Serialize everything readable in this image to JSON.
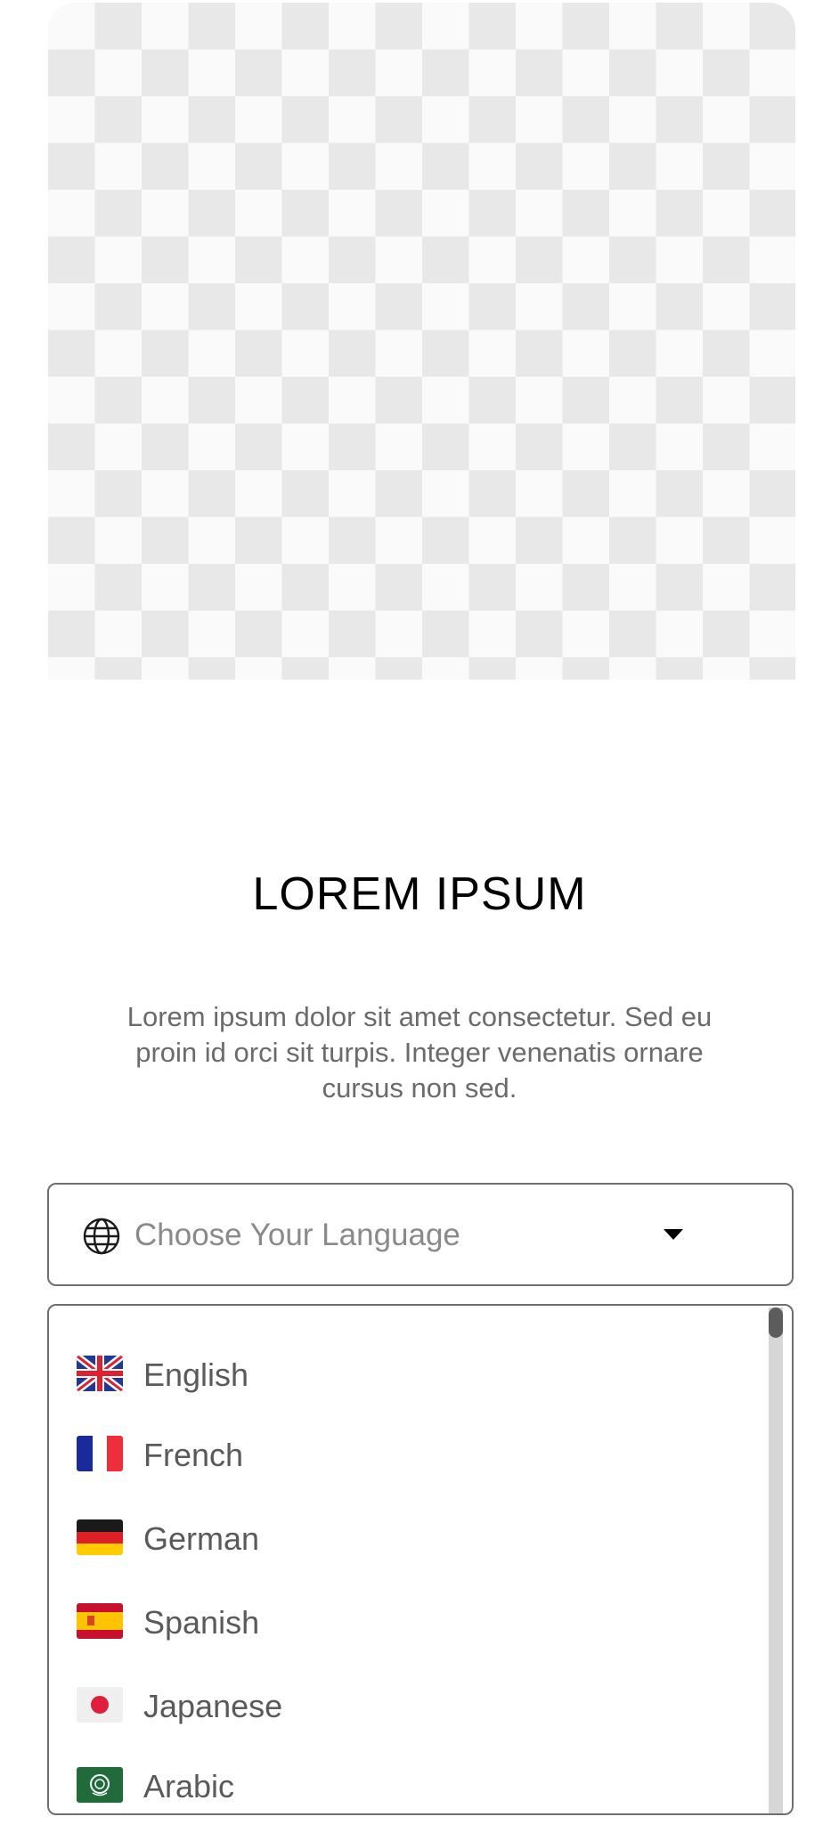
{
  "hero": {
    "image_icon": "checkerboard-placeholder-icon"
  },
  "title": "LOREM IPSUM",
  "description": "Lorem ipsum dolor sit amet consectetur. Sed eu proin id orci sit turpis. Integer venenatis ornare cursus non sed.",
  "language_select": {
    "placeholder": "Choose Your Language",
    "leading_icon": "globe-icon",
    "trailing_icon": "caret-down-icon"
  },
  "languages": [
    {
      "label": "English",
      "flag_icon": "uk-flag-icon"
    },
    {
      "label": "French",
      "flag_icon": "france-flag-icon"
    },
    {
      "label": "German",
      "flag_icon": "germany-flag-icon"
    },
    {
      "label": "Spanish",
      "flag_icon": "spain-flag-icon"
    },
    {
      "label": "Japanese",
      "flag_icon": "japan-flag-icon"
    },
    {
      "label": "Arabic",
      "flag_icon": "arab-league-flag-icon"
    }
  ],
  "colors": {
    "border": "#6f6f6f",
    "placeholder_text": "#8a8a8a",
    "body_text": "#6b6b6b",
    "scroll_track": "#d6d6d6",
    "scroll_thumb": "#5c5c5c"
  }
}
